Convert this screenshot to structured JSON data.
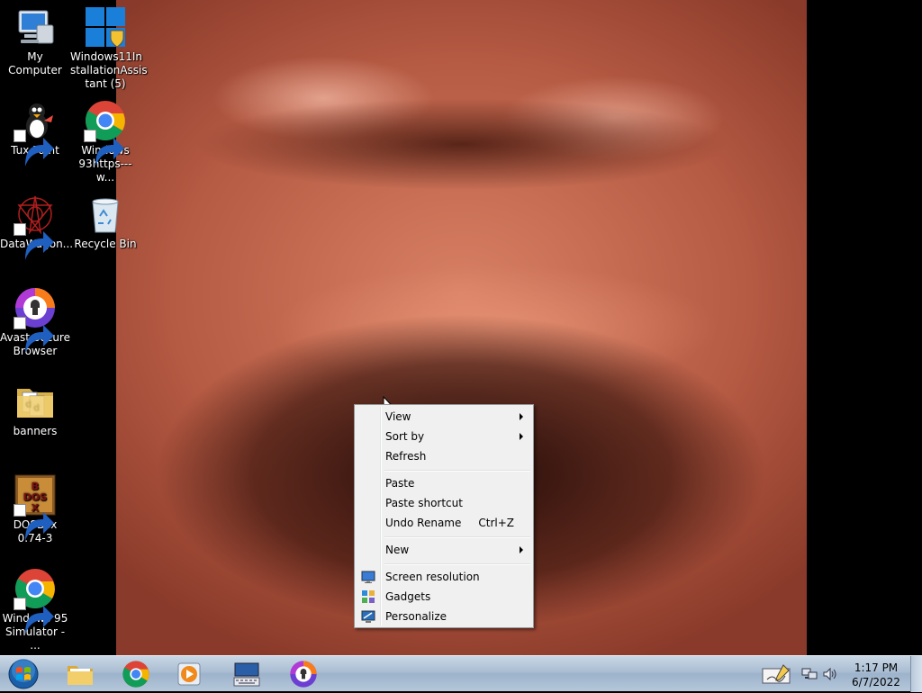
{
  "desktop": {
    "icons": [
      {
        "label": "My Computer",
        "icon": "computer-icon",
        "shortcut": false
      },
      {
        "label": "Windows11InstallationAssistant (5)",
        "line1": "Windows11In",
        "line2": "stallationAssis",
        "line3": "tant (5)",
        "icon": "windows11-logo-icon",
        "shortcut": false
      },
      {
        "label": "Tux Paint",
        "icon": "tux-paint-icon",
        "shortcut": true
      },
      {
        "label": "Windows 93https---w...",
        "line1": "Windows",
        "line2": "93https---w...",
        "icon": "chrome-icon",
        "shortcut": true
      },
      {
        "label": "DataWagon...",
        "icon": "datawagon-icon",
        "shortcut": true
      },
      {
        "label": "Recycle Bin",
        "icon": "recycle-bin-icon",
        "shortcut": false
      },
      {
        "label": "Avast Secure Browser",
        "line1": "Avast Secure",
        "line2": "Browser",
        "icon": "avast-browser-icon",
        "shortcut": true
      },
      {
        "label": "banners",
        "icon": "folder-icon",
        "shortcut": false
      },
      {
        "label": "DOSBox 0.74-3",
        "line1": "DOSBox",
        "line2": "0.74-3",
        "icon": "dosbox-icon",
        "shortcut": true
      },
      {
        "label": "Windows 95 Simulator - ...",
        "line1": "Windows 95",
        "line2": "Simulator - ...",
        "icon": "chrome-icon",
        "shortcut": true
      }
    ]
  },
  "context_menu": {
    "items": [
      {
        "label": "View",
        "submenu": true
      },
      {
        "label": "Sort by",
        "submenu": true
      },
      {
        "label": "Refresh"
      },
      {
        "label": "Paste"
      },
      {
        "label": "Paste shortcut"
      },
      {
        "label": "Undo Rename",
        "shortcut": "Ctrl+Z"
      },
      {
        "label": "New",
        "submenu": true
      },
      {
        "label": "Screen resolution",
        "icon": "screen-resolution-icon"
      },
      {
        "label": "Gadgets",
        "icon": "gadgets-icon"
      },
      {
        "label": "Personalize",
        "icon": "personalize-icon"
      }
    ]
  },
  "taskbar": {
    "pinned": [
      "file-explorer-icon",
      "chrome-icon",
      "media-player-icon",
      "on-screen-keyboard-icon",
      "avast-browser-icon"
    ],
    "clock": {
      "time": "1:17 PM",
      "date": "6/7/2022"
    }
  },
  "colors": {
    "taskbar": "#b5c7da",
    "menu_bg": "#f0f0f0"
  }
}
